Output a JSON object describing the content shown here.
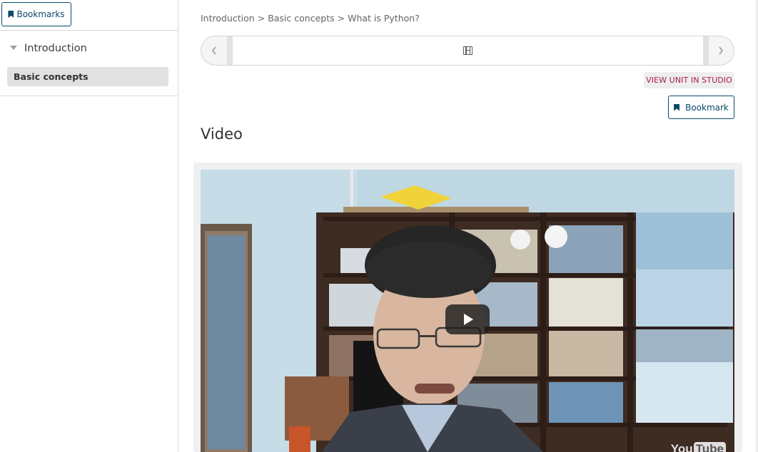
{
  "sidebar": {
    "bookmarks_label": "Bookmarks",
    "chapter_label": "Introduction",
    "section_label": "Basic concepts"
  },
  "breadcrumb": {
    "items": [
      "Introduction",
      "Basic concepts",
      "What is Python?"
    ],
    "separator": ">"
  },
  "sequence_nav": {
    "prev_icon": "chevron-left-icon",
    "next_icon": "chevron-right-icon",
    "unit_icon": "film-icon"
  },
  "unit": {
    "studio_label": "VIEW UNIT IN STUDIO",
    "bookmark_label": "Bookmark",
    "title": "Video"
  },
  "video": {
    "play_icon": "play-icon",
    "logo": {
      "you": "You",
      "tube": "Tube"
    }
  },
  "colors": {
    "accent": "#0a4a6a",
    "studio": "#a81d3d",
    "selected_bg": "#e1e1e1"
  }
}
